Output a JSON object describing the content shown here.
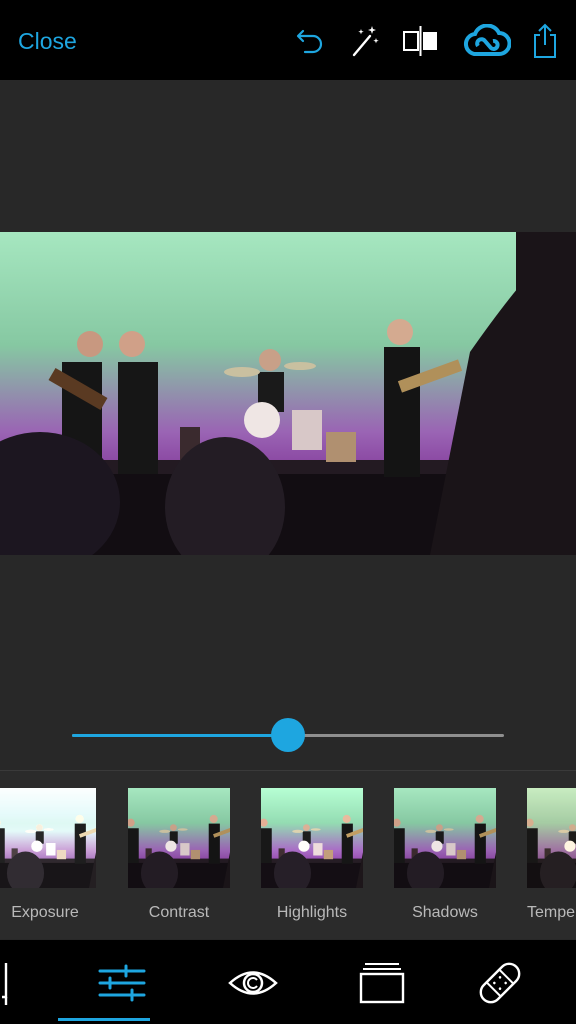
{
  "header": {
    "close_label": "Close",
    "icons": [
      "undo-icon",
      "magic-wand-icon",
      "compare-icon",
      "creative-cloud-icon",
      "share-icon"
    ],
    "accent": "#1ea6e0"
  },
  "adjustment_slider": {
    "value": 0.5
  },
  "adjustments": [
    {
      "label": "Exposure"
    },
    {
      "label": "Contrast"
    },
    {
      "label": "Highlights"
    },
    {
      "label": "Shadows"
    },
    {
      "label": "Tempe"
    }
  ],
  "bottom_tools": [
    "crop-icon",
    "adjustments-icon",
    "eye-icon",
    "frames-icon",
    "healing-bandage-icon"
  ],
  "active_tool": "adjustments-icon"
}
